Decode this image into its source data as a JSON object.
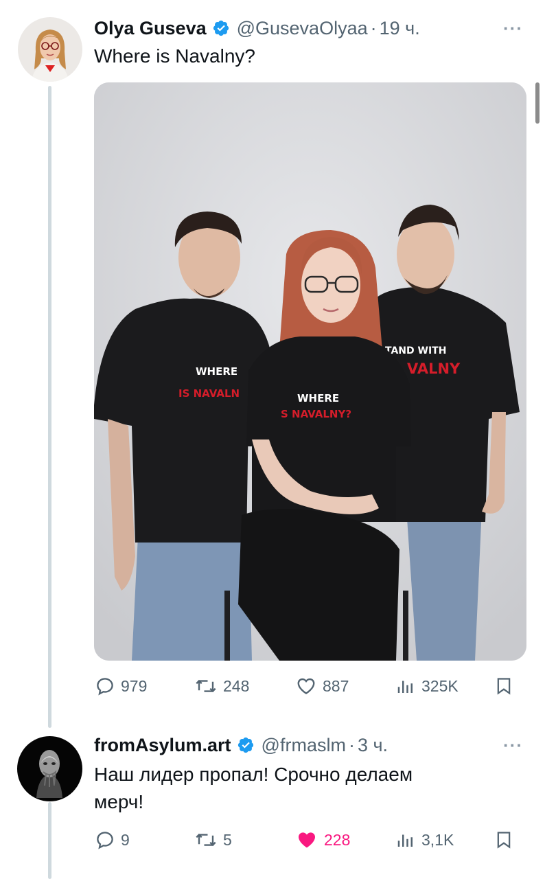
{
  "tweet1": {
    "display_name": "Olya Guseva",
    "handle": "@GusevaOlyaa",
    "separator": "·",
    "time": "19 ч.",
    "text": "Where is Navalny?",
    "more_label": "···",
    "media": {
      "shirt_left_line1": "WHERE",
      "shirt_left_line2": "IS NAVALN",
      "shirt_center_line1": "WHERE",
      "shirt_center_line2": "S NAVALNY?",
      "shirt_right_line1": "TAND WITH",
      "shirt_right_line2": "VALNY"
    },
    "actions": {
      "replies": "979",
      "reposts": "248",
      "likes": "887",
      "views": "325K"
    }
  },
  "tweet2": {
    "display_name": "fromAsylum.art",
    "handle": "@frmaslm",
    "separator": "·",
    "time": "3 ч.",
    "text_line1": "Наш лидер пропал! Срочно делаем",
    "text_line2": "мерч!",
    "more_label": "···",
    "actions": {
      "replies": "9",
      "reposts": "5",
      "likes": "228",
      "views": "3,1K"
    }
  },
  "colors": {
    "verified": "#1d9bf0",
    "like_active": "#f91880",
    "secondary_text": "#536471",
    "thread_line": "#cfd9de"
  },
  "icons": [
    "verified-badge-icon",
    "reply-icon",
    "repost-icon",
    "like-icon",
    "views-icon",
    "bookmark-icon",
    "more-icon"
  ]
}
